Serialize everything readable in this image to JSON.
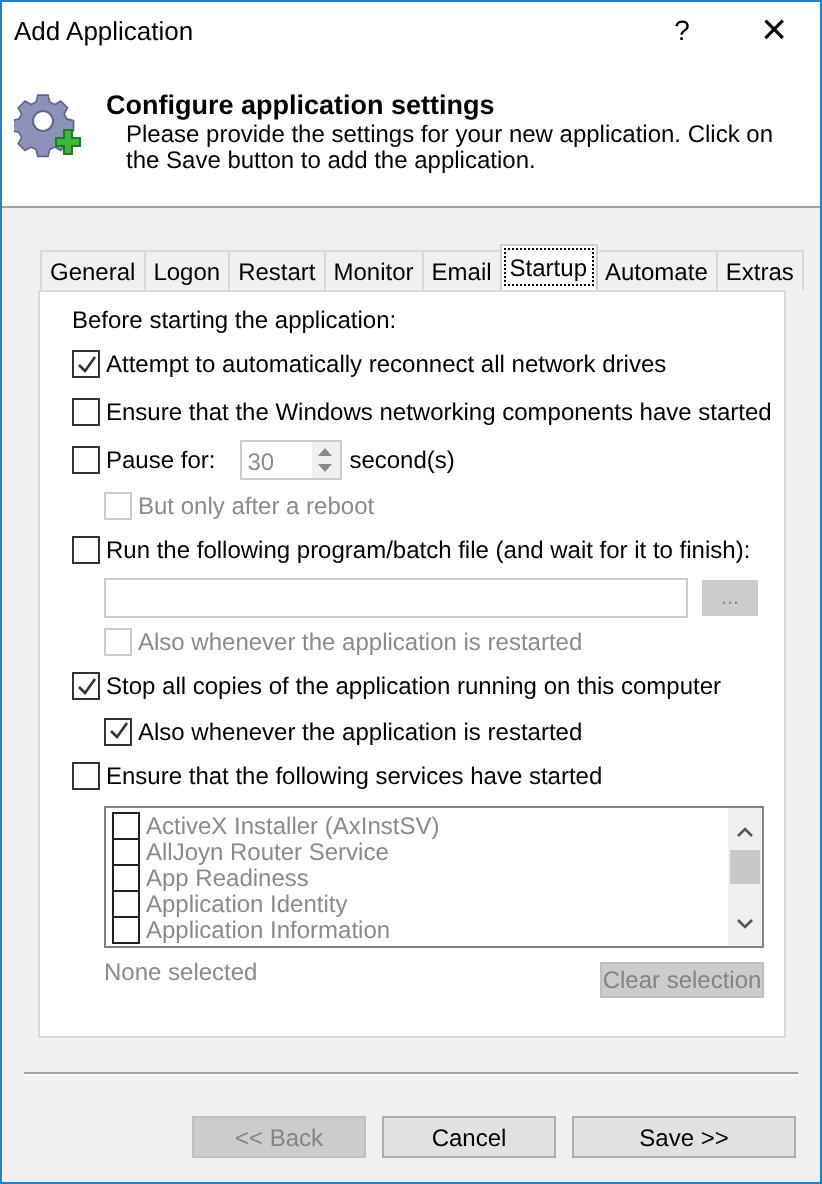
{
  "window": {
    "title": "Add Application",
    "help_label": "?",
    "close_label": "×"
  },
  "header": {
    "title": "Configure application settings",
    "description": "Please provide the settings for your new application. Click on the Save button to add the application."
  },
  "tabs": [
    {
      "label": "General",
      "selected": false
    },
    {
      "label": "Logon",
      "selected": false
    },
    {
      "label": "Restart",
      "selected": false
    },
    {
      "label": "Monitor",
      "selected": false
    },
    {
      "label": "Email",
      "selected": false
    },
    {
      "label": "Startup",
      "selected": true
    },
    {
      "label": "Automate",
      "selected": false
    },
    {
      "label": "Extras",
      "selected": false
    }
  ],
  "startup": {
    "heading": "Before starting the application:",
    "options": [
      {
        "kind": "checkbox",
        "label": "Attempt to automatically reconnect all network drives",
        "checked": true,
        "disabled": false
      },
      {
        "kind": "checkbox",
        "label": "Ensure that the Windows networking components have started",
        "checked": false,
        "disabled": false
      },
      {
        "kind": "pause",
        "label": "Pause for:",
        "checked": false,
        "disabled": false,
        "value": "30",
        "unit": "second(s)",
        "children": [
          {
            "label": "But only after a reboot",
            "checked": false,
            "disabled": true
          }
        ]
      },
      {
        "kind": "program",
        "label": "Run the following program/batch file (and wait for it to finish):",
        "checked": false,
        "disabled": false,
        "browse_label": "...",
        "children": [
          {
            "label": "Also whenever the application is restarted",
            "checked": false,
            "disabled": true
          }
        ]
      },
      {
        "kind": "checkbox",
        "label": "Stop all copies of the application running on this computer",
        "checked": true,
        "disabled": false,
        "children": [
          {
            "label": "Also whenever the application is restarted",
            "checked": true,
            "disabled": false
          }
        ]
      },
      {
        "kind": "services",
        "label": "Ensure that the following services have started",
        "checked": false,
        "disabled": false,
        "services": [
          {
            "label": "ActiveX Installer (AxInstSV)",
            "checked": false
          },
          {
            "label": "AllJoyn Router Service",
            "checked": false
          },
          {
            "label": "App Readiness",
            "checked": false
          },
          {
            "label": "Application Identity",
            "checked": false
          },
          {
            "label": "Application Information",
            "checked": false
          }
        ],
        "status": "None selected",
        "clear_label": "Clear selection",
        "clear_disabled": true
      }
    ]
  },
  "buttons": [
    {
      "label": "<< Back",
      "disabled": true
    },
    {
      "label": "Cancel",
      "disabled": false
    },
    {
      "label": "Save >>",
      "disabled": false
    }
  ]
}
